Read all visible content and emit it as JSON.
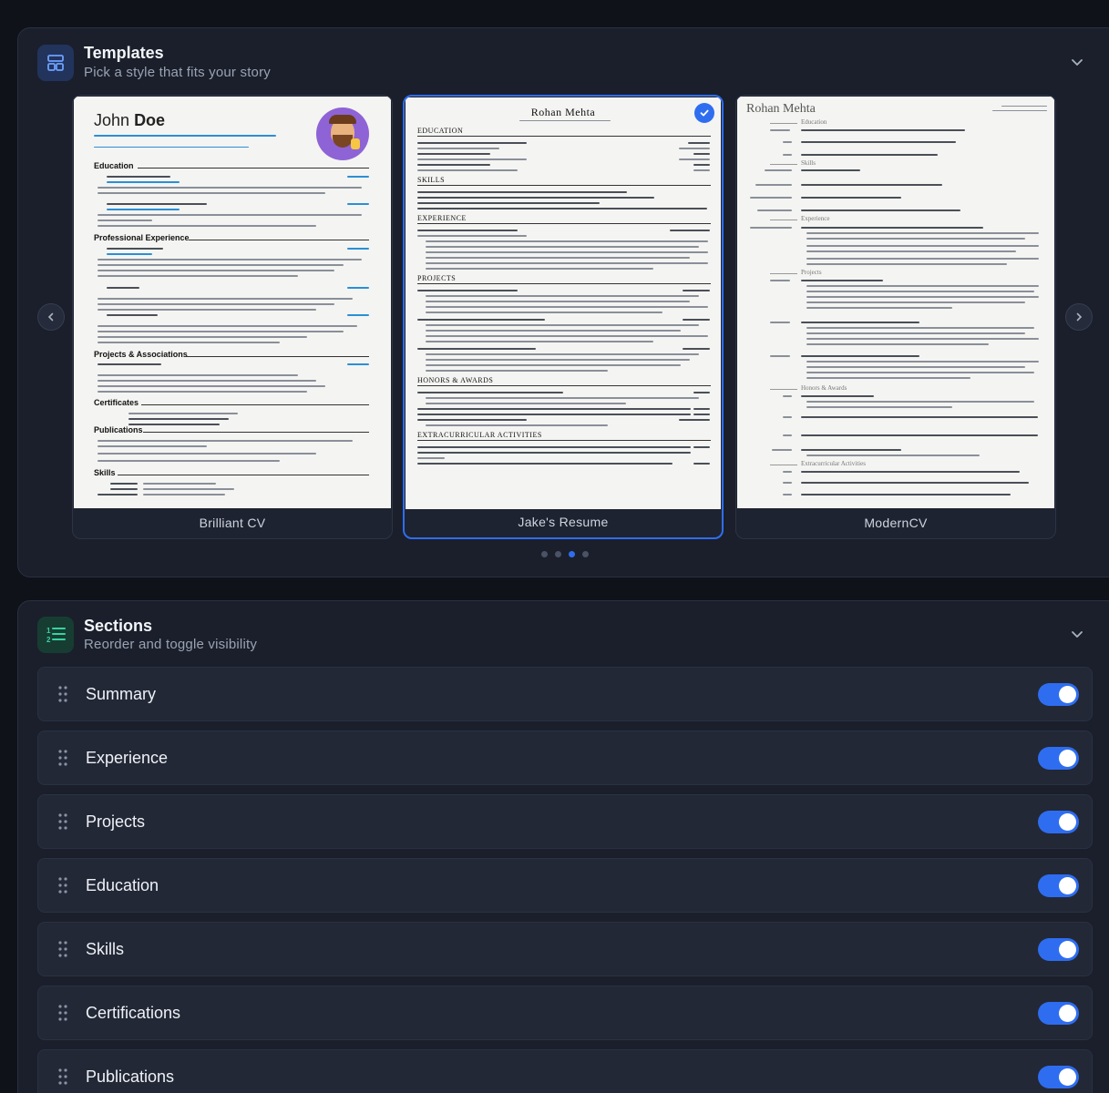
{
  "templates": {
    "title": "Templates",
    "subtitle": "Pick a style that fits your story",
    "icon": "layout-icon",
    "cards": [
      {
        "label": "Brilliant CV",
        "selected": false,
        "preview": {
          "name_first": "John",
          "name_last": "Doe",
          "sections": [
            "Education",
            "Professional Experience",
            "Projects & Associations",
            "Certificates",
            "Publications",
            "Skills"
          ]
        }
      },
      {
        "label": "Jake's Resume",
        "selected": true,
        "preview": {
          "name": "Rohan Mehta",
          "sections": [
            "Education",
            "Skills",
            "Experience",
            "Projects",
            "Honors & Awards",
            "Extracurricular Activities"
          ]
        }
      },
      {
        "label": "ModernCV",
        "selected": false,
        "preview": {
          "name": "Rohan Mehta",
          "sections": [
            "Education",
            "Skills",
            "Experience",
            "Projects",
            "Honors & Awards",
            "Extracurricular Activities"
          ]
        }
      }
    ],
    "carousel": {
      "dots": 4,
      "active_dot": 2
    }
  },
  "sections": {
    "title": "Sections",
    "subtitle": "Reorder and toggle visibility",
    "icon": "numbered-list-icon",
    "items": [
      {
        "label": "Summary",
        "visible": true
      },
      {
        "label": "Experience",
        "visible": true
      },
      {
        "label": "Projects",
        "visible": true
      },
      {
        "label": "Education",
        "visible": true
      },
      {
        "label": "Skills",
        "visible": true
      },
      {
        "label": "Certifications",
        "visible": true
      },
      {
        "label": "Publications",
        "visible": true
      }
    ]
  },
  "colors": {
    "accent": "#2f6df0",
    "panel": "#1a1f2b",
    "background": "#0f1219",
    "toggle_on": "#2f6df0"
  }
}
